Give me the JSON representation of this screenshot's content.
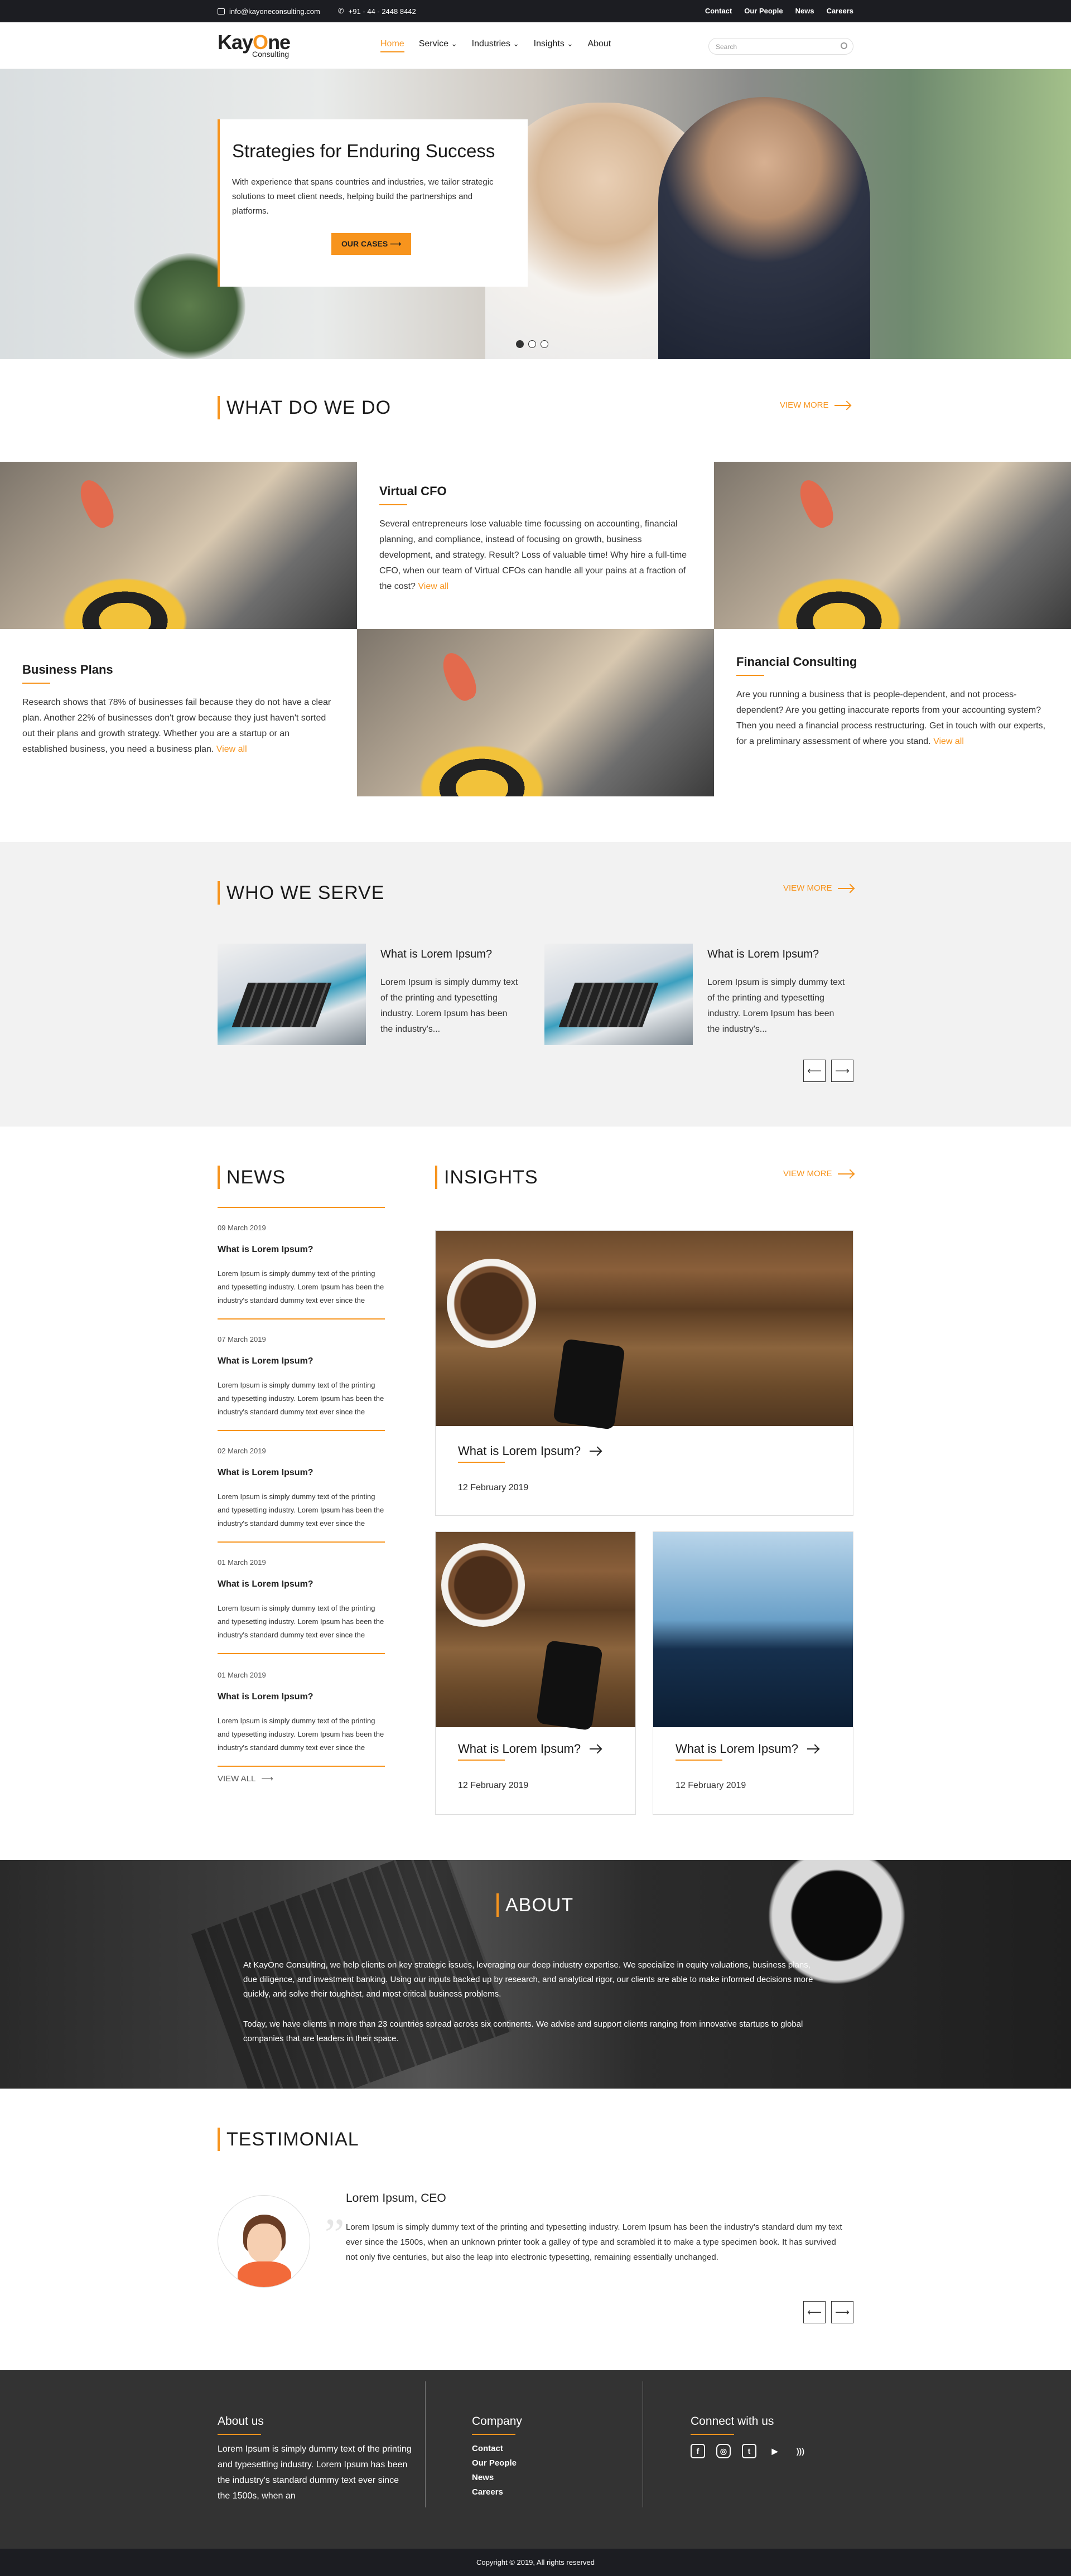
{
  "topbar": {
    "email": "info@kayoneconsulting.com",
    "phone": "+91 - 44 - 2448 8442",
    "links": [
      "Contact",
      "Our People",
      "News",
      "Careers"
    ]
  },
  "brand": {
    "name_pre": "Kay",
    "name_o": "O",
    "name_post": "ne",
    "sub": "Consulting"
  },
  "nav": {
    "items": [
      "Home",
      "Service",
      "Industries",
      "Insights",
      "About"
    ],
    "active": "Home",
    "search_placeholder": "Search"
  },
  "hero": {
    "title": "Strategies for Enduring Success",
    "text": "With experience that spans countries and industries, we tailor strategic solutions to meet client needs, helping build the partnerships and platforms.",
    "cta": "OUR CASES",
    "slides": 3,
    "active_slide": 1
  },
  "what": {
    "title": "WHAT DO WE DO",
    "view_more": "VIEW MORE",
    "virtual": {
      "title": "Virtual CFO",
      "text": "Several entrepreneurs lose valuable time focussing on accounting, financial planning, and compliance, instead of focusing on growth, business development, and strategy. Result? Loss of valuable time! Why hire a full-time CFO, when our team of Virtual CFOs can handle all your pains at a fraction of the cost?",
      "link": "View all"
    },
    "business": {
      "title": "Business Plans",
      "text": "Research shows that 78% of businesses fail because they do not have a clear plan. Another 22% of businesses don't grow because they just haven't sorted out their plans and growth strategy. Whether you are a startup or an established business, you need a business plan.",
      "link": "View all"
    },
    "financial": {
      "title": "Financial Consulting",
      "text": "Are you running a business that is people-dependent, and not process-dependent? Are you getting inaccurate reports from your accounting system? Then you need a financial process restructuring. Get in touch with our experts, for a preliminary assessment of where you stand.",
      "link": "View all"
    }
  },
  "serve": {
    "title": "WHO WE SERVE",
    "view_more": "VIEW MORE",
    "items": [
      {
        "title": "What is Lorem Ipsum?",
        "text": "Lorem Ipsum is simply dummy text of the printing and typesetting industry. Lorem Ipsum has been the industry's..."
      },
      {
        "title": "What is Lorem Ipsum?",
        "text": "Lorem Ipsum is simply dummy text of the printing and typesetting industry. Lorem Ipsum has been the industry's..."
      }
    ]
  },
  "news": {
    "title": "NEWS",
    "view_all": "VIEW ALL",
    "items": [
      {
        "date": "09 March 2019",
        "title": "What is Lorem Ipsum?",
        "text": "Lorem Ipsum is simply dummy text of the printing and typesetting industry. Lorem Ipsum has been the industry's standard dummy text ever since the"
      },
      {
        "date": "07 March 2019",
        "title": "What is Lorem Ipsum?",
        "text": "Lorem Ipsum is simply dummy text of the printing and typesetting industry. Lorem Ipsum has been the industry's standard dummy text ever since the"
      },
      {
        "date": "02 March 2019",
        "title": "What is Lorem Ipsum?",
        "text": "Lorem Ipsum is simply dummy text of the printing and typesetting industry. Lorem Ipsum has been the industry's standard dummy text ever since the"
      },
      {
        "date": "01 March 2019",
        "title": "What is Lorem Ipsum?",
        "text": "Lorem Ipsum is simply dummy text of the printing and typesetting industry. Lorem Ipsum has been the industry's standard dummy text ever since the"
      },
      {
        "date": "01 March 2019",
        "title": "What is Lorem Ipsum?",
        "text": "Lorem Ipsum is simply dummy text of the printing and typesetting industry. Lorem Ipsum has been the industry's standard dummy text ever since the"
      }
    ]
  },
  "insights": {
    "title": "INSIGHTS",
    "view_more": "VIEW MORE",
    "items": [
      {
        "title": "What is Lorem Ipsum?",
        "date": "12 February 2019"
      },
      {
        "title": "What is Lorem Ipsum?",
        "date": "12 February 2019"
      },
      {
        "title": "What is Lorem Ipsum?",
        "date": "12 February 2019"
      }
    ]
  },
  "about": {
    "title": "ABOUT",
    "p1": "At KayOne Consulting, we help clients on key strategic issues, leveraging our deep industry expertise. We specialize in equity valuations, business plans, due diligence, and investment banking. Using our inputs backed up by research, and analytical rigor, our clients are able to make informed decisions more quickly, and solve their toughest, and most critical business problems.",
    "p2": "Today, we have clients in more than 23 countries spread across six continents. We advise and support clients ranging from innovative startups to global companies that are leaders in their space."
  },
  "testimonial": {
    "title": "TESTIMONIAL",
    "name": "Lorem Ipsum, CEO",
    "text": "Lorem Ipsum is simply dummy text of the printing and typesetting industry. Lorem Ipsum has been the industry's standard dum my text ever since the 1500s, when an unknown printer took a galley of type and scrambled it to make a type specimen book. It has survived not only five centuries, but also the leap into electronic typesetting, remaining essentially unchanged."
  },
  "footer": {
    "about_title": "About us",
    "about_text": "Lorem Ipsum is simply dummy text of the printing and typesetting industry. Lorem Ipsum has been the industry's standard dummy text ever since the 1500s, when an",
    "company_title": "Company",
    "company_links": [
      "Contact",
      "Our People",
      "News",
      "Careers"
    ],
    "connect_title": "Connect with us",
    "social": [
      "facebook-icon",
      "instagram-icon",
      "twitter-icon",
      "youtube-icon",
      "rss-icon"
    ],
    "copyright": "Copyright © 2019, All rights reserved"
  },
  "colors": {
    "accent": "#f7941d",
    "dark": "#1c1d22",
    "footer": "#333333"
  }
}
